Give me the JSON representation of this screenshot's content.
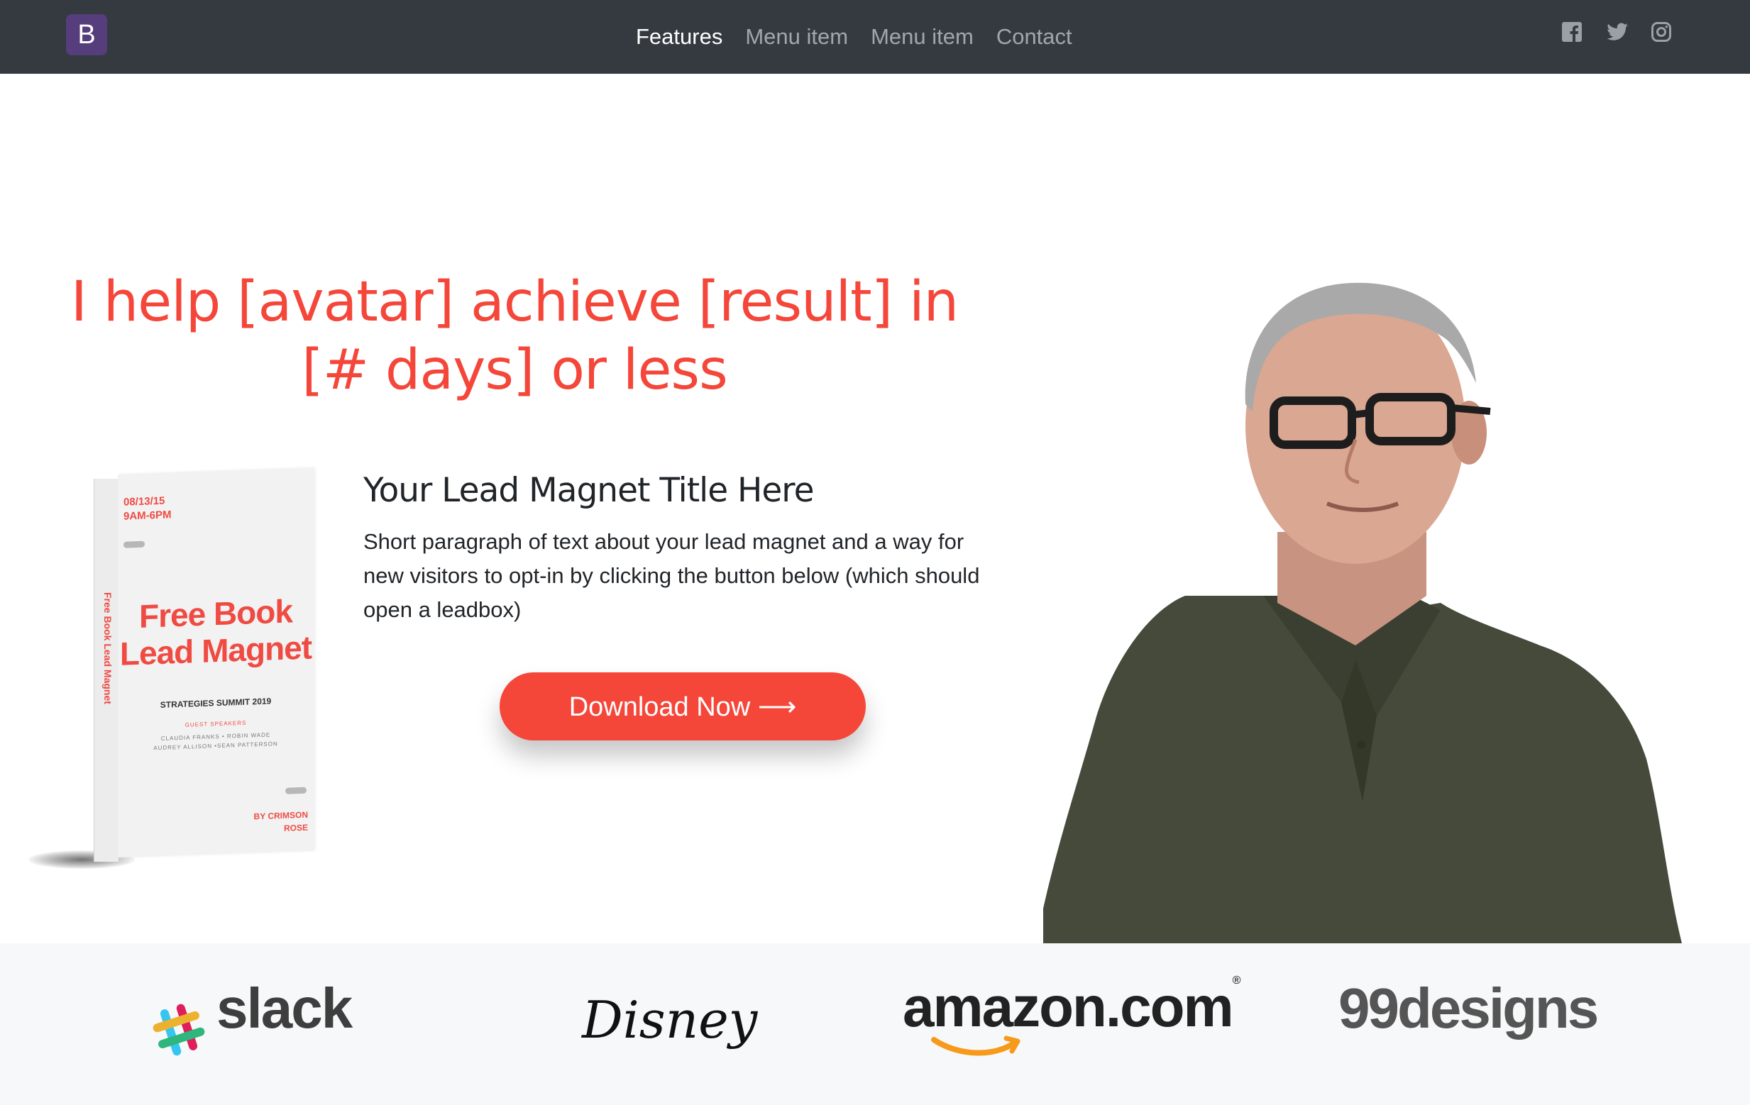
{
  "navbar": {
    "brand": "B",
    "links": [
      {
        "label": "Features",
        "active": true
      },
      {
        "label": "Menu item",
        "active": false
      },
      {
        "label": "Menu item",
        "active": false
      },
      {
        "label": "Contact",
        "active": false
      }
    ],
    "social": [
      "facebook-icon",
      "twitter-icon",
      "instagram-icon"
    ],
    "background": "#343a40",
    "brand_color": "#563d7c"
  },
  "hero": {
    "headline_line1": "I help [avatar] achieve [result] in",
    "headline_line2": "[# days] or less",
    "accent_color": "#f5463a"
  },
  "book": {
    "date": "08/13/15",
    "time": "9AM-6PM",
    "title_line1": "Free Book",
    "title_line2": "Lead Magnet",
    "summit": "STRATEGIES SUMMIT 2019",
    "guest_label": "GUEST SPEAKERS",
    "names_line1": "CLAUDIA FRANKS • ROBIN WADE",
    "names_line2": "AUDREY ALLISON •SEAN PATTERSON",
    "author_line1": "BY CRIMSON",
    "author_line2": "ROSE",
    "spine_text": "Free Book Lead Magnet"
  },
  "lead_magnet": {
    "title": "Your Lead Magnet Title Here",
    "paragraph": "Short paragraph of text about your lead magnet and a way for new visitors to opt-in by clicking the button below (which should open a leadbox)",
    "cta_label": "Download Now ⟶"
  },
  "logos": {
    "slack": "slack",
    "disney": "Disney",
    "amazon": "amazon.com",
    "amazon_reg": "®",
    "designs": "99designs"
  }
}
